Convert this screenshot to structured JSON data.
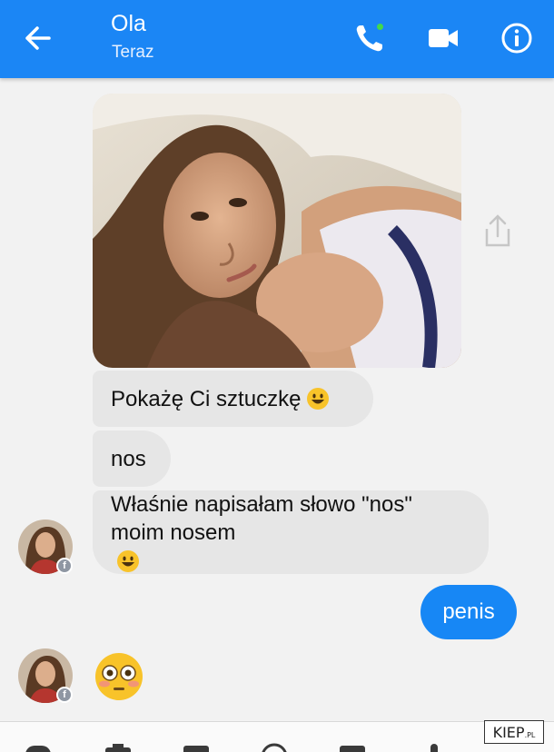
{
  "header": {
    "title": "Ola",
    "subtitle": "Teraz"
  },
  "icons": {
    "back": "arrow-left-icon",
    "call": "phone-icon",
    "video": "video-camera-icon",
    "info": "info-icon",
    "share": "share-icon"
  },
  "messages": {
    "m1": "Pokażę Ci sztuczkę",
    "m2": "nos",
    "m3_line1": "Właśnie napisałam słowo \"nos\"",
    "m3_line2": "moim nosem",
    "sent": "penis"
  },
  "watermark": {
    "main": "KIEP",
    "suffix": ".PL"
  },
  "colors": {
    "header": "#1b86f5",
    "sent_bubble": "#1787f5",
    "received_bubble": "#e6e6e6",
    "online": "#43d94a"
  }
}
